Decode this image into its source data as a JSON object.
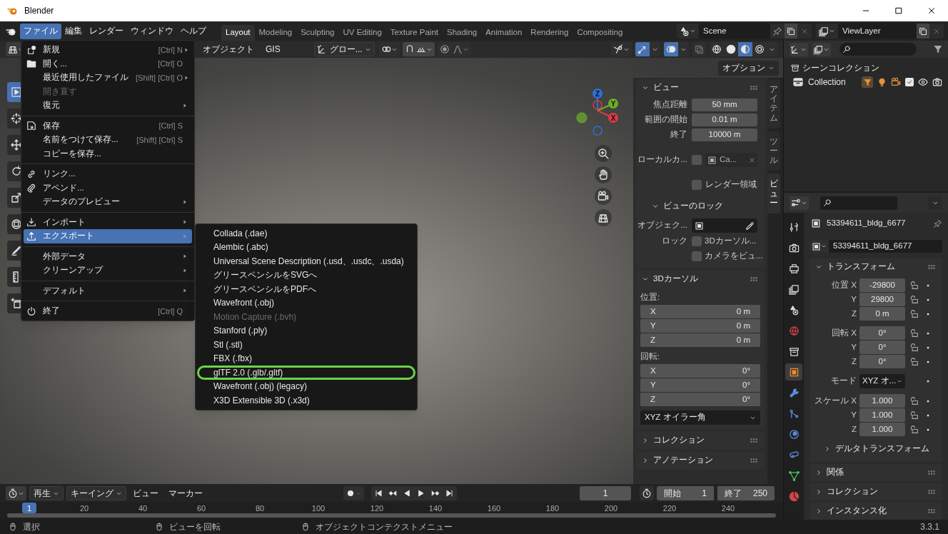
{
  "window": {
    "title": "Blender"
  },
  "menubar": [
    {
      "label": "ファイル",
      "selected": true
    },
    {
      "label": "編集",
      "selected": false
    },
    {
      "label": "レンダー",
      "selected": false
    },
    {
      "label": "ウィンドウ",
      "selected": false
    },
    {
      "label": "ヘルプ",
      "selected": false
    }
  ],
  "workspaces": [
    {
      "label": "Layout",
      "selected": true
    },
    {
      "label": "Modeling",
      "selected": false
    },
    {
      "label": "Sculpting",
      "selected": false
    },
    {
      "label": "UV Editing",
      "selected": false
    },
    {
      "label": "Texture Paint",
      "selected": false
    },
    {
      "label": "Shading",
      "selected": false
    },
    {
      "label": "Animation",
      "selected": false
    },
    {
      "label": "Rendering",
      "selected": false
    },
    {
      "label": "Compositing",
      "selected": false
    }
  ],
  "scene": {
    "name": "Scene"
  },
  "view_layer": {
    "name": "ViewLayer"
  },
  "viewport_header": {
    "menus": [
      "オブジェクト",
      "GIS"
    ],
    "transform_orientation": "グロー...",
    "options": "オプション"
  },
  "gizmo": {
    "axes": [
      "Z",
      "Y",
      "X"
    ]
  },
  "file_menu": [
    {
      "kind": "item",
      "label": "新規",
      "shortcut": "[Ctrl] N",
      "submenu": true,
      "disabled": false,
      "selected": false
    },
    {
      "kind": "item",
      "label": "開く...",
      "shortcut": "[Ctrl] O",
      "submenu": false,
      "disabled": false,
      "selected": false
    },
    {
      "kind": "item",
      "label": "最近使用したファイル",
      "shortcut": "[Shift] [Ctrl] O",
      "submenu": true,
      "disabled": false,
      "selected": false
    },
    {
      "kind": "item",
      "label": "開き直す",
      "submenu": false,
      "disabled": true,
      "selected": false
    },
    {
      "kind": "item",
      "label": "復元",
      "submenu": true,
      "disabled": false,
      "selected": false
    },
    {
      "kind": "separator"
    },
    {
      "kind": "item",
      "label": "保存",
      "shortcut": "[Ctrl] S",
      "submenu": false,
      "disabled": false,
      "selected": false
    },
    {
      "kind": "item",
      "label": "名前をつけて保存...",
      "shortcut": "[Shift] [Ctrl] S",
      "submenu": false,
      "disabled": false,
      "selected": false
    },
    {
      "kind": "item",
      "label": "コピーを保存...",
      "submenu": false,
      "disabled": false,
      "selected": false
    },
    {
      "kind": "separator"
    },
    {
      "kind": "item",
      "label": "リンク...",
      "submenu": false,
      "disabled": false,
      "selected": false
    },
    {
      "kind": "item",
      "label": "アペンド...",
      "submenu": false,
      "disabled": false,
      "selected": false
    },
    {
      "kind": "item",
      "label": "データのプレビュー",
      "submenu": true,
      "disabled": false,
      "selected": false
    },
    {
      "kind": "separator"
    },
    {
      "kind": "item",
      "label": "インポート",
      "submenu": true,
      "disabled": false,
      "selected": false
    },
    {
      "kind": "item",
      "label": "エクスポート",
      "submenu": true,
      "disabled": false,
      "selected": true
    },
    {
      "kind": "separator"
    },
    {
      "kind": "item",
      "label": "外部データ",
      "submenu": true,
      "disabled": false,
      "selected": false
    },
    {
      "kind": "item",
      "label": "クリーンアップ",
      "submenu": true,
      "disabled": false,
      "selected": false
    },
    {
      "kind": "separator"
    },
    {
      "kind": "item",
      "label": "デフォルト",
      "submenu": true,
      "disabled": false,
      "selected": false
    },
    {
      "kind": "separator"
    },
    {
      "kind": "item",
      "label": "終了",
      "shortcut": "[Ctrl] Q",
      "submenu": false,
      "disabled": false,
      "selected": false
    }
  ],
  "export_menu": [
    {
      "label": "Collada (.dae)",
      "disabled": false,
      "circled": false
    },
    {
      "label": "Alembic (.abc)",
      "disabled": false,
      "circled": false
    },
    {
      "label": "Universal Scene Description (.usd、.usdc、.usda)",
      "disabled": false,
      "circled": false
    },
    {
      "label": "グリースペンシルをSVGへ",
      "disabled": false,
      "circled": false
    },
    {
      "label": "グリースペンシルをPDFへ",
      "disabled": false,
      "circled": false
    },
    {
      "label": "Wavefront (.obj)",
      "disabled": false,
      "circled": false
    },
    {
      "label": "Motion Capture (.bvh)",
      "disabled": true,
      "circled": false
    },
    {
      "label": "Stanford (.ply)",
      "disabled": false,
      "circled": false
    },
    {
      "label": "Stl (.stl)",
      "disabled": false,
      "circled": false
    },
    {
      "label": "FBX (.fbx)",
      "disabled": false,
      "circled": false
    },
    {
      "label": "glTF 2.0 (.glb/.gltf)",
      "disabled": false,
      "circled": true
    },
    {
      "label": "Wavefront (.obj) (legacy)",
      "disabled": false,
      "circled": false
    },
    {
      "label": "X3D Extensible 3D (.x3d)",
      "disabled": false,
      "circled": false
    }
  ],
  "n_panel": {
    "tabs": [
      {
        "label": "アイテム",
        "selected": false
      },
      {
        "label": "ツール",
        "selected": false
      },
      {
        "label": "ビュー",
        "selected": true
      }
    ],
    "view": {
      "title": "ビュー",
      "expanded": true,
      "fields": [
        {
          "label": "焦点距離",
          "value": "50 mm"
        },
        {
          "label": "範囲の開始",
          "value": "0.01 m"
        },
        {
          "label": "終了",
          "value": "10000 m"
        }
      ],
      "local_camera": {
        "label": "ローカルカ...",
        "checked": false,
        "value": "Ca..."
      },
      "render_region": {
        "label": "レンダー領域",
        "checked": false
      },
      "lock": {
        "title": "ビューのロック",
        "expanded": true,
        "object_label": "オブジェク...",
        "lock_label": "ロック",
        "options": [
          {
            "label": "3Dカーソル...",
            "checked": false
          },
          {
            "label": "カメラをビュ...",
            "checked": false
          }
        ]
      }
    },
    "cursor": {
      "title": "3Dカーソル",
      "expanded": true,
      "location_label": "位置:",
      "location": [
        {
          "axis": "X",
          "value": "0 m"
        },
        {
          "axis": "Y",
          "value": "0 m"
        },
        {
          "axis": "Z",
          "value": "0 m"
        }
      ],
      "rotation_label": "回転:",
      "rotation": [
        {
          "axis": "X",
          "value": "0°"
        },
        {
          "axis": "Y",
          "value": "0°"
        },
        {
          "axis": "Z",
          "value": "0°"
        }
      ],
      "rotation_mode": "XYZ オイラー角"
    },
    "panels": [
      {
        "title": "コレクション",
        "expanded": false
      },
      {
        "title": "アノテーション",
        "expanded": false
      }
    ]
  },
  "outliner": {
    "root": "シーンコレクション",
    "items": [
      {
        "label": "Collection",
        "checked": true
      }
    ]
  },
  "properties": {
    "tabs": [
      {
        "selected": false
      },
      {
        "selected": false
      },
      {
        "selected": false
      },
      {
        "selected": false
      },
      {
        "selected": false
      },
      {
        "selected": false
      },
      {
        "selected": false
      },
      {
        "selected": true
      },
      {
        "selected": false
      },
      {
        "selected": false
      },
      {
        "selected": false
      },
      {
        "selected": false
      },
      {
        "selected": false
      },
      {
        "selected": false
      }
    ],
    "object_name": "53394611_bldg_6677",
    "data_name": "53394611_bldg_6677",
    "transform": {
      "title": "トランスフォーム",
      "expanded": true,
      "rows": [
        {
          "kind": "vector",
          "label": "位置",
          "items": [
            {
              "axis": "X",
              "value": "-29800"
            },
            {
              "axis": "Y",
              "value": "29800"
            },
            {
              "axis": "Z",
              "value": "0 m"
            }
          ]
        },
        {
          "kind": "vector",
          "label": "回転",
          "items": [
            {
              "axis": "X",
              "value": "0°"
            },
            {
              "axis": "Y",
              "value": "0°"
            },
            {
              "axis": "Z",
              "value": "0°"
            }
          ]
        },
        {
          "kind": "dropdown",
          "label": "モード",
          "value": "XYZ オ..."
        },
        {
          "kind": "vector",
          "label": "スケール",
          "items": [
            {
              "axis": "X",
              "value": "1.000"
            },
            {
              "axis": "Y",
              "value": "1.000"
            },
            {
              "axis": "Z",
              "value": "1.000"
            }
          ]
        }
      ],
      "subpanels": [
        {
          "title": "デルタトランスフォーム",
          "expanded": false
        }
      ]
    },
    "panels": [
      {
        "title": "関係",
        "expanded": false
      },
      {
        "title": "コレクション",
        "expanded": false
      },
      {
        "title": "インスタンス化",
        "expanded": false
      }
    ]
  },
  "timeline": {
    "menus": [
      {
        "label": "再生",
        "dropdown": true
      },
      {
        "label": "キーイング",
        "dropdown": true
      },
      {
        "label": "ビュー",
        "dropdown": false
      },
      {
        "label": "マーカー",
        "dropdown": false
      }
    ],
    "current_frame": "1",
    "start_label": "開始",
    "start": "1",
    "end_label": "終了",
    "end": "250",
    "playhead": "1",
    "ticks": [
      "20",
      "40",
      "60",
      "80",
      "100",
      "120",
      "140",
      "160",
      "180",
      "200",
      "220",
      "240"
    ]
  },
  "status_bar": {
    "hints": [
      "選択",
      "ビューを回転",
      "オブジェクトコンテクストメニュー"
    ],
    "version": "3.3.1"
  }
}
